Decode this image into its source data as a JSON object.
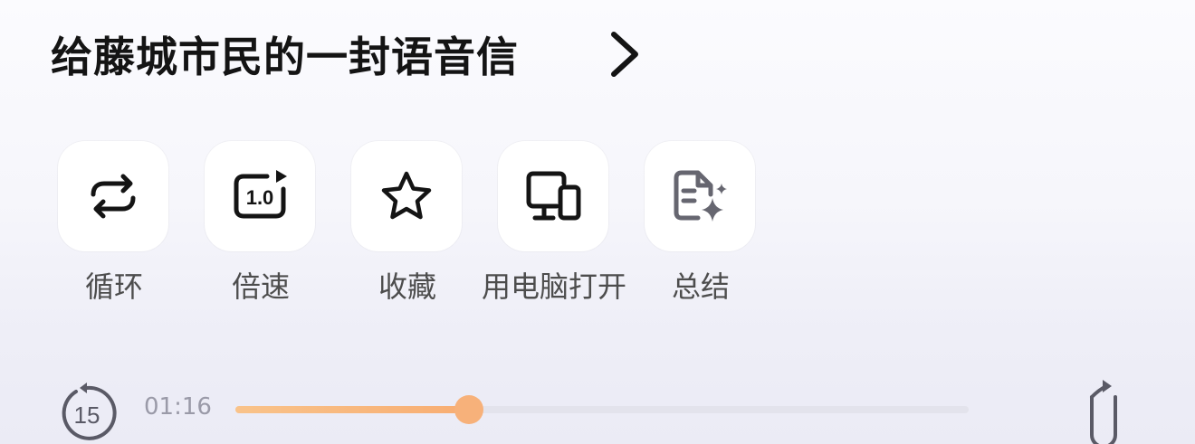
{
  "header": {
    "title": "给藤城市民的一封语音信",
    "chevron_icon": "chevron-right-icon"
  },
  "actions": [
    {
      "label": "循环",
      "icon": "loop-icon"
    },
    {
      "label": "倍速",
      "icon": "playback-speed-icon",
      "speed_text": "1.0"
    },
    {
      "label": "收藏",
      "icon": "star-icon"
    },
    {
      "label": "用电脑打开",
      "icon": "monitor-phone-icon"
    },
    {
      "label": "总结",
      "icon": "ai-summary-icon"
    }
  ],
  "player": {
    "rewind_seconds": "15",
    "current_time": "01:16",
    "progress_fraction": 0.318,
    "rewind_icon": "rewind-15-icon",
    "forward_icon": "forward-icon"
  },
  "colors": {
    "progress_accent": "#f8ad72",
    "title_text": "#141414",
    "label_text": "#4d4d4d",
    "time_text": "#9a9aa8",
    "tile_bg": "#ffffff"
  }
}
